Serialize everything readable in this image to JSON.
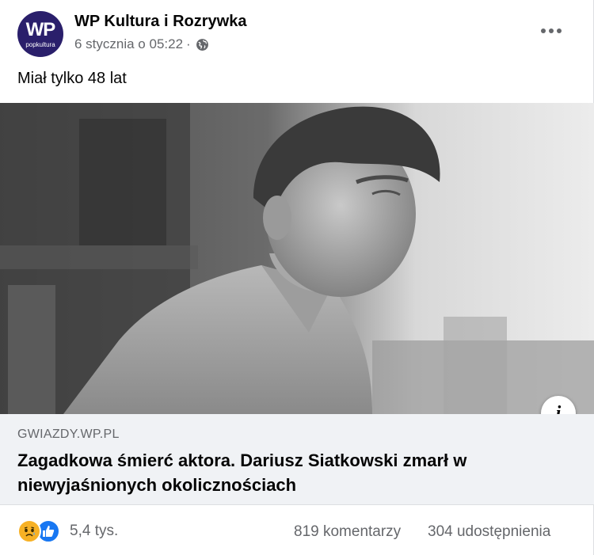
{
  "post": {
    "page_name": "WP Kultura i Rozrywka",
    "avatar": {
      "logo_text": "WP",
      "logo_sub": "popkultura",
      "color": "#2a1f6b"
    },
    "timestamp": "6 stycznia o 05:22",
    "separator": "·",
    "privacy_icon": "globe-icon",
    "more_icon": "more-options-icon",
    "text": "Miał tylko 48 lat"
  },
  "image": {
    "description_icon": "info-icon",
    "info_label": "i"
  },
  "link": {
    "domain": "GWIAZDY.WP.PL",
    "headline": "Zagadkowa śmierć aktora. Dariusz Siatkowski zmarł w niewyjaśnionych okolicznościach"
  },
  "footer": {
    "reaction_icons": [
      "sad-reaction-icon",
      "like-reaction-icon"
    ],
    "reaction_count": "5,4 tys.",
    "comments": "819 komentarzy",
    "shares": "304 udostępnienia"
  },
  "colors": {
    "secondary_text": "#65676b",
    "link_background": "#f0f2f5",
    "like_blue": "#1877f2",
    "sad_yellow": "#f7b125"
  }
}
